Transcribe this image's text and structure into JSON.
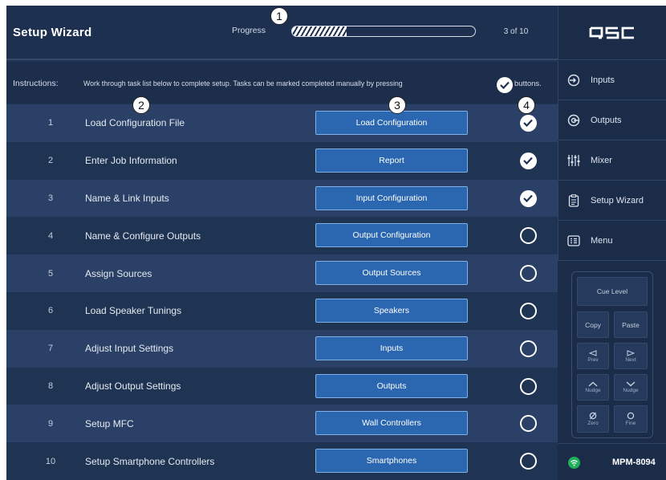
{
  "header": {
    "title": "Setup Wizard",
    "progress_label": "Progress",
    "progress_fraction": 0.3,
    "progress_count": "3 of 10"
  },
  "instructions": {
    "label": "Instructions:",
    "text": "Work through task list below to complete setup. Tasks can be marked completed manually by pressing",
    "suffix": "buttons."
  },
  "callouts": [
    "1",
    "2",
    "3",
    "4"
  ],
  "tasks": [
    {
      "num": "1",
      "name": "Load Configuration File",
      "button": "Load Configuration",
      "done": true
    },
    {
      "num": "2",
      "name": "Enter Job Information",
      "button": "Report",
      "done": true
    },
    {
      "num": "3",
      "name": "Name & Link Inputs",
      "button": "Input Configuration",
      "done": true
    },
    {
      "num": "4",
      "name": "Name & Configure Outputs",
      "button": "Output Configuration",
      "done": false
    },
    {
      "num": "5",
      "name": "Assign Sources",
      "button": "Output Sources",
      "done": false
    },
    {
      "num": "6",
      "name": "Load Speaker Tunings",
      "button": "Speakers",
      "done": false
    },
    {
      "num": "7",
      "name": "Adjust Input Settings",
      "button": "Inputs",
      "done": false
    },
    {
      "num": "8",
      "name": "Adjust Output Settings",
      "button": "Outputs",
      "done": false
    },
    {
      "num": "9",
      "name": "Setup MFC",
      "button": "Wall Controllers",
      "done": false
    },
    {
      "num": "10",
      "name": "Setup Smartphone Controllers",
      "button": "Smartphones",
      "done": false
    }
  ],
  "sidebar": {
    "logo": "QSC",
    "nav": [
      {
        "label": "Inputs",
        "icon": "inputs-icon"
      },
      {
        "label": "Outputs",
        "icon": "outputs-icon"
      },
      {
        "label": "Mixer",
        "icon": "mixer-icon"
      },
      {
        "label": "Setup Wizard",
        "icon": "clipboard-icon"
      },
      {
        "label": "Menu",
        "icon": "menu-icon"
      }
    ],
    "remote": {
      "cue_level": "Cue Level",
      "copy": "Copy",
      "paste": "Paste",
      "prev": "Prev",
      "next": "Next",
      "nudge_up": "Nudge",
      "nudge_down": "Nudge",
      "zero": "Zero",
      "fine": "Fine"
    },
    "device_name": "MPM-8094"
  },
  "colors": {
    "background": "#1f3352",
    "row_alt": "#2a4066",
    "button": "#2a67b0",
    "wifi": "#20b05b"
  }
}
